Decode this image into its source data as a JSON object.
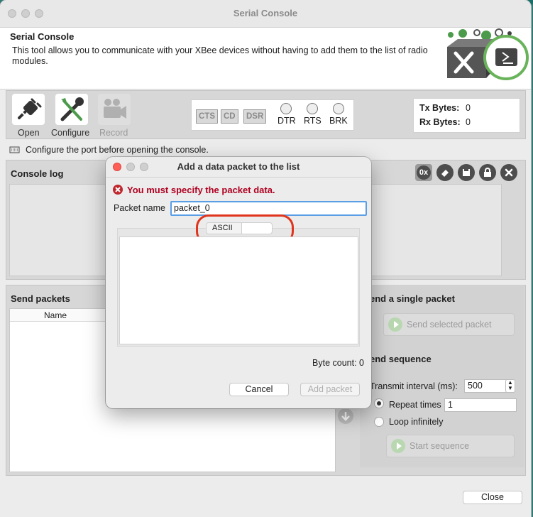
{
  "window": {
    "title": "Serial Console"
  },
  "header": {
    "title": "Serial Console",
    "description": "This tool allows you to communicate with your XBee devices without having to add them to the list of radio modules."
  },
  "toolbar": {
    "open_label": "Open",
    "configure_label": "Configure",
    "record_label": "Record"
  },
  "signals": {
    "cts": "CTS",
    "cd": "CD",
    "dsr": "DSR",
    "dtr": "DTR",
    "rts": "RTS",
    "brk": "BRK"
  },
  "bytes": {
    "tx_label": "Tx Bytes:",
    "tx_value": "0",
    "rx_label": "Rx Bytes:",
    "rx_value": "0"
  },
  "status": {
    "message": "Configure the port before opening the console."
  },
  "console_log": {
    "title": "Console log",
    "hex_icon_label": "0x"
  },
  "send_packets": {
    "title": "Send packets",
    "column_name": "Name"
  },
  "send_single": {
    "title": "end a single packet",
    "button": "Send selected packet"
  },
  "send_sequence": {
    "title": "end sequence",
    "interval_label": "Transmit interval (ms):",
    "interval_value": "500",
    "repeat_label": "Repeat times",
    "repeat_value": "1",
    "loop_label": "Loop infinitely",
    "start_button": "Start sequence"
  },
  "footer": {
    "close_button": "Close"
  },
  "dialog": {
    "title": "Add a data packet to the list",
    "error": "You must specify the packet data.",
    "name_label": "Packet name",
    "name_value": "packet_0",
    "format_label": "ASCII",
    "byte_count": "Byte count: 0",
    "cancel_button": "Cancel",
    "add_button": "Add packet"
  },
  "colors": {
    "error": "#b00020",
    "focus": "#5a9ee6",
    "highlight": "#e0341c",
    "accent": "#4c9b4c"
  }
}
